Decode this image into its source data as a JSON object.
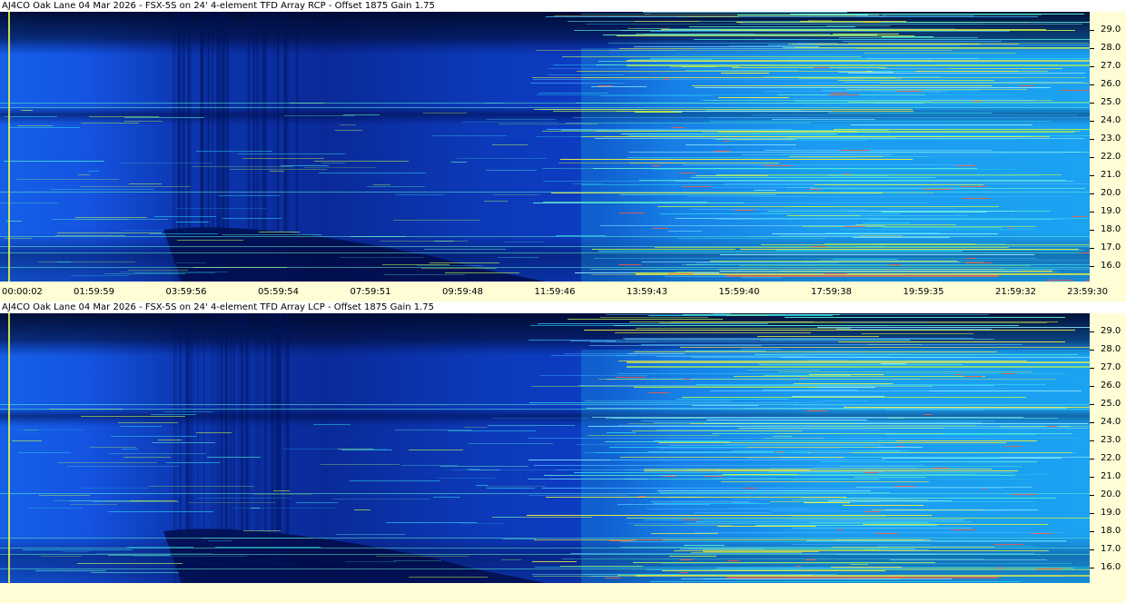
{
  "panels": [
    {
      "id": "rcp",
      "title": "AJ4CO Oak Lane 04 Mar 2026 - FSX-5S on 24' 4-element TFD Array RCP  -  Offset 1875  Gain 1.75"
    },
    {
      "id": "lcp",
      "title": "AJ4CO Oak Lane 04 Mar 2026 - FSX-5S on 24' 4-element TFD Array LCP  -  Offset 1875  Gain 1.75"
    }
  ],
  "frequency_labels": [
    "29.0",
    "28.0",
    "27.0",
    "26.0",
    "25.0",
    "24.0",
    "23.0",
    "22.0",
    "21.0",
    "20.0",
    "19.0",
    "18.0",
    "17.0",
    "16.0"
  ],
  "time_labels": [
    "00:00:02",
    "01:59:59",
    "03:59:56",
    "05:59:54",
    "07:59:51",
    "09:59:48",
    "11:59:46",
    "13:59:43",
    "15:59:40",
    "17:59:38",
    "19:59:35",
    "21:59:32",
    "23:59:30"
  ],
  "colors": {
    "background": "#fffdd6",
    "title_bar": "#ffffff",
    "low_signal": "#000a40",
    "mid_signal": "#0a3ccf",
    "high_signal": "#1ec8f0",
    "burst": "#f0f040",
    "hot": "#ff5a3c"
  }
}
